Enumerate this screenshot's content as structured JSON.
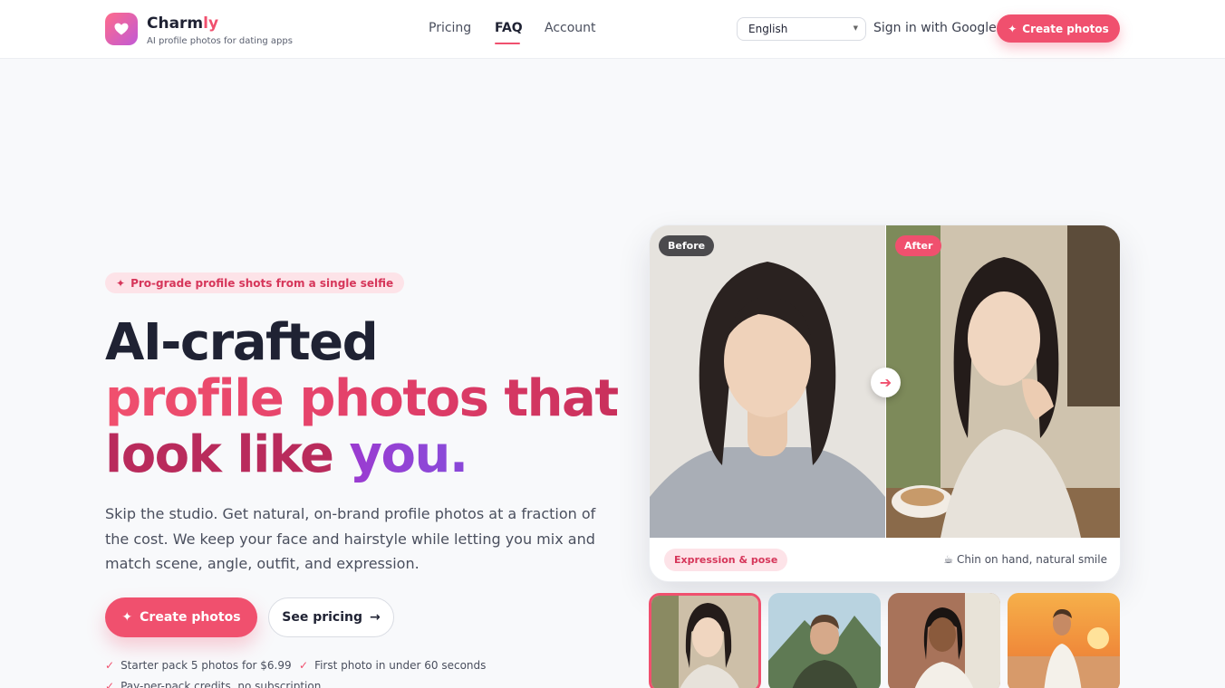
{
  "brand": {
    "name_main": "Charm",
    "name_accent": "ly",
    "tagline": "AI profile photos for dating apps"
  },
  "nav": [
    {
      "label": "Pricing"
    },
    {
      "label": "FAQ"
    },
    {
      "label": "Account"
    }
  ],
  "language": {
    "selected": "English"
  },
  "header": {
    "signin_label": "Sign in with Google",
    "cta_label": "Create photos"
  },
  "hero": {
    "pill": "Pro-grade profile shots from a single selfie",
    "line1": "AI-crafted",
    "line2": "profile photos that",
    "line3a": "look like ",
    "line3b": "you",
    "line3c": ".",
    "lead": "Skip the studio. Get natural, on-brand profile photos at a fraction of the cost. We keep your face and hairstyle while letting you mix and match scene, angle, outfit, and expression.",
    "primary_cta": "Create photos",
    "secondary_cta": "See pricing",
    "checks": [
      "Starter pack 5 photos for $6.99",
      "First photo in under 60 seconds",
      "Pay-per-pack credits, no subscription"
    ]
  },
  "compare": {
    "before_label": "Before",
    "after_label": "After",
    "style_badge": "Expression & pose",
    "caption": "☕ Chin on hand, natural smile"
  },
  "thumbnails": [
    {
      "name": "woman-cafe",
      "selected": true
    },
    {
      "name": "man-mountain",
      "selected": false
    },
    {
      "name": "woman-street",
      "selected": false
    },
    {
      "name": "man-beach-sunset",
      "selected": false
    }
  ],
  "colors": {
    "accent": "#f0506e",
    "purple": "#8a47d8",
    "text": "#1f2233"
  }
}
